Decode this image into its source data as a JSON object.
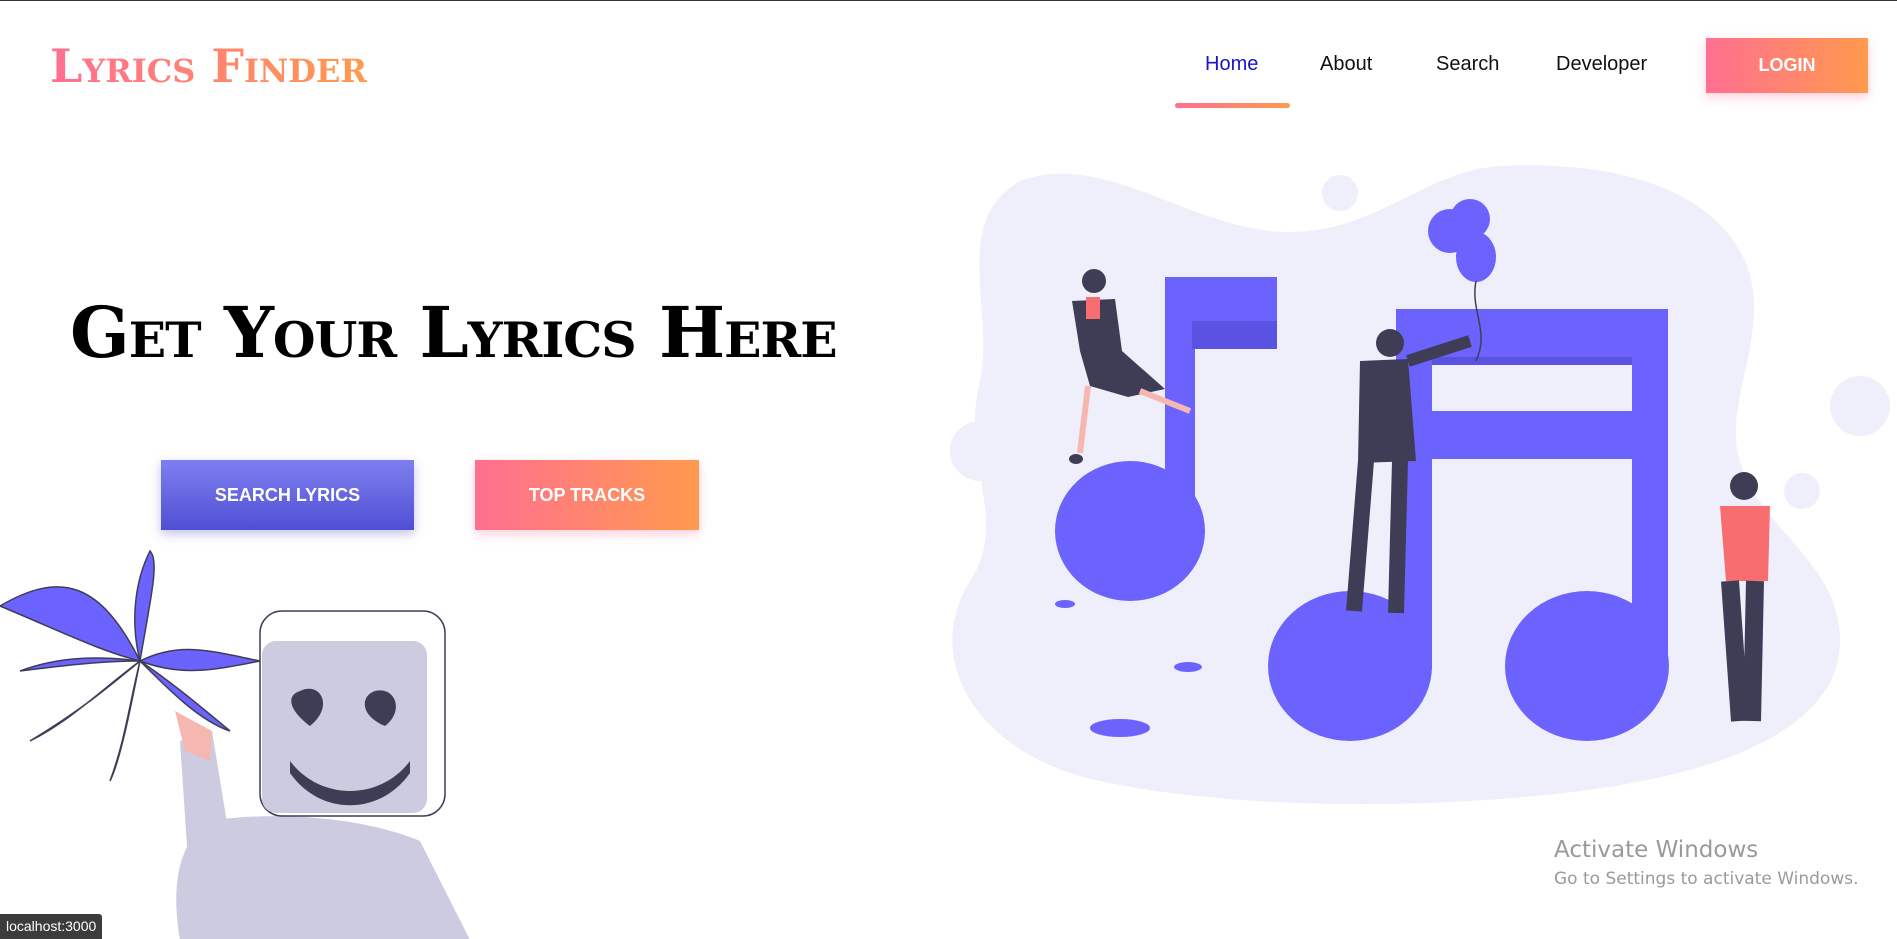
{
  "brand": {
    "logo_text": "Lyrics Finder"
  },
  "nav": {
    "items": [
      {
        "label": "Home",
        "active": true
      },
      {
        "label": "About",
        "active": false
      },
      {
        "label": "Search",
        "active": false
      },
      {
        "label": "Developer",
        "active": false
      }
    ],
    "login_label": "LOGIN"
  },
  "hero": {
    "headline": "Get Your Lyrics Here",
    "search_button": "SEARCH LYRICS",
    "top_tracks_button": "TOP TRACKS"
  },
  "overlay": {
    "activate_title": "Activate Windows",
    "activate_subtitle": "Go to Settings to activate Windows."
  },
  "status_bar": {
    "url": "localhost:3000"
  },
  "colors": {
    "accent_start": "#ff6f91",
    "accent_end": "#ff9a4d",
    "primary_purple": "#6c63ff",
    "nav_active": "#1a14c9"
  }
}
